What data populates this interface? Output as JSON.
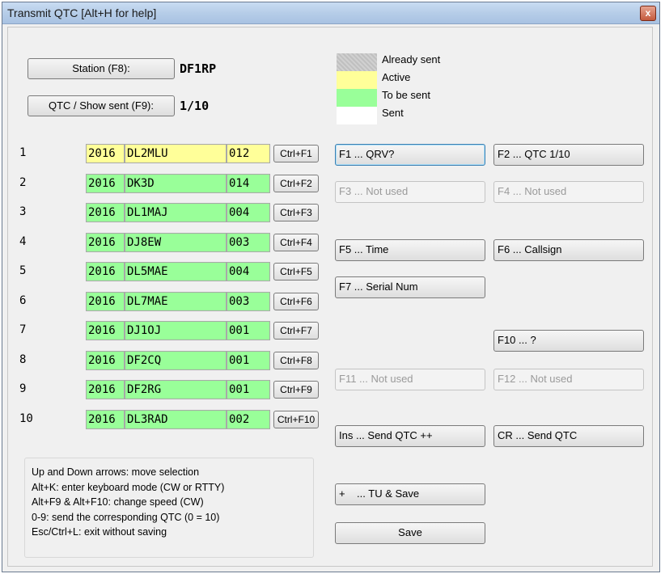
{
  "window": {
    "title": "Transmit QTC [Alt+H for help]",
    "close_label": "x"
  },
  "station": {
    "button_label_prefix": "Station (F8):",
    "callsign": "DF1RP"
  },
  "qtc": {
    "button_label": "QTC / Show sent (F9):",
    "count": "1/10"
  },
  "legend": [
    {
      "label": "Already sent",
      "color": "#c8c8c8"
    },
    {
      "label": "Active",
      "color": "#ffff99"
    },
    {
      "label": "To be sent",
      "color": "#99ff99"
    },
    {
      "label": "Sent",
      "color": "#ffffff"
    }
  ],
  "rows": [
    {
      "num": "1",
      "year": "2016",
      "call": "DL2MLU",
      "serial": "012",
      "key": "Ctrl+F1",
      "state": "active"
    },
    {
      "num": "2",
      "year": "2016",
      "call": "DK3D",
      "serial": "014",
      "key": "Ctrl+F2",
      "state": "pending"
    },
    {
      "num": "3",
      "year": "2016",
      "call": "DL1MAJ",
      "serial": "004",
      "key": "Ctrl+F3",
      "state": "pending"
    },
    {
      "num": "4",
      "year": "2016",
      "call": "DJ8EW",
      "serial": "003",
      "key": "Ctrl+F4",
      "state": "pending"
    },
    {
      "num": "5",
      "year": "2016",
      "call": "DL5MAE",
      "serial": "004",
      "key": "Ctrl+F5",
      "state": "pending"
    },
    {
      "num": "6",
      "year": "2016",
      "call": "DL7MAE",
      "serial": "003",
      "key": "Ctrl+F6",
      "state": "pending"
    },
    {
      "num": "7",
      "year": "2016",
      "call": "DJ1OJ",
      "serial": "001",
      "key": "Ctrl+F7",
      "state": "pending"
    },
    {
      "num": "8",
      "year": "2016",
      "call": "DF2CQ",
      "serial": "001",
      "key": "Ctrl+F8",
      "state": "pending"
    },
    {
      "num": "9",
      "year": "2016",
      "call": "DF2RG",
      "serial": "001",
      "key": "Ctrl+F9",
      "state": "pending"
    },
    {
      "num": "10",
      "year": "2016",
      "call": "DL3RAD",
      "serial": "002",
      "key": "Ctrl+F10",
      "state": "pending"
    }
  ],
  "function_keys": {
    "f1": "F1 ... QRV?",
    "f2": "F2 ... QTC 1/10",
    "f3": "F3 ... Not used",
    "f4": "F4 ... Not used",
    "f5": "F5 ... Time",
    "f6": "F6 ... Callsign",
    "f7": "F7 ... Serial Num",
    "f10": "F10 ... ?",
    "f11": "F11 ... Not used",
    "f12": "F12 ... Not used",
    "ins": "Ins ... Send QTC ++",
    "cr": "CR ... Send QTC",
    "plus": "+    ... TU & Save",
    "save": "Save"
  },
  "help": [
    "Up and Down arrows: move selection",
    "Alt+K: enter keyboard mode (CW or RTTY)",
    "Alt+F9 & Alt+F10: change speed (CW)",
    "0-9: send the corresponding QTC (0 = 10)",
    "Esc/Ctrl+L: exit without saving"
  ],
  "colors": {
    "active": "#ffff99",
    "pending": "#99ff99",
    "sent_before": "#c8c8c8",
    "sent": "#ffffff"
  }
}
